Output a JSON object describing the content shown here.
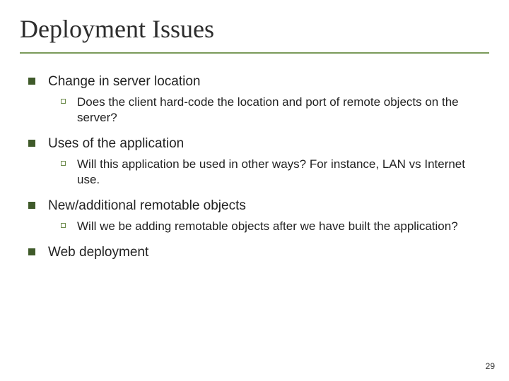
{
  "title": "Deployment Issues",
  "items": [
    {
      "label": "Change in server location",
      "sub": [
        "Does the client hard-code the location and port of remote objects on the server?"
      ]
    },
    {
      "label": "Uses of the application",
      "sub": [
        "Will this application be used in other ways? For instance, LAN vs Internet use."
      ]
    },
    {
      "label": "New/additional remotable objects",
      "sub": [
        "Will we be adding remotable objects after we have built the application?"
      ]
    },
    {
      "label": "Web deployment",
      "sub": []
    }
  ],
  "page_number": "29"
}
